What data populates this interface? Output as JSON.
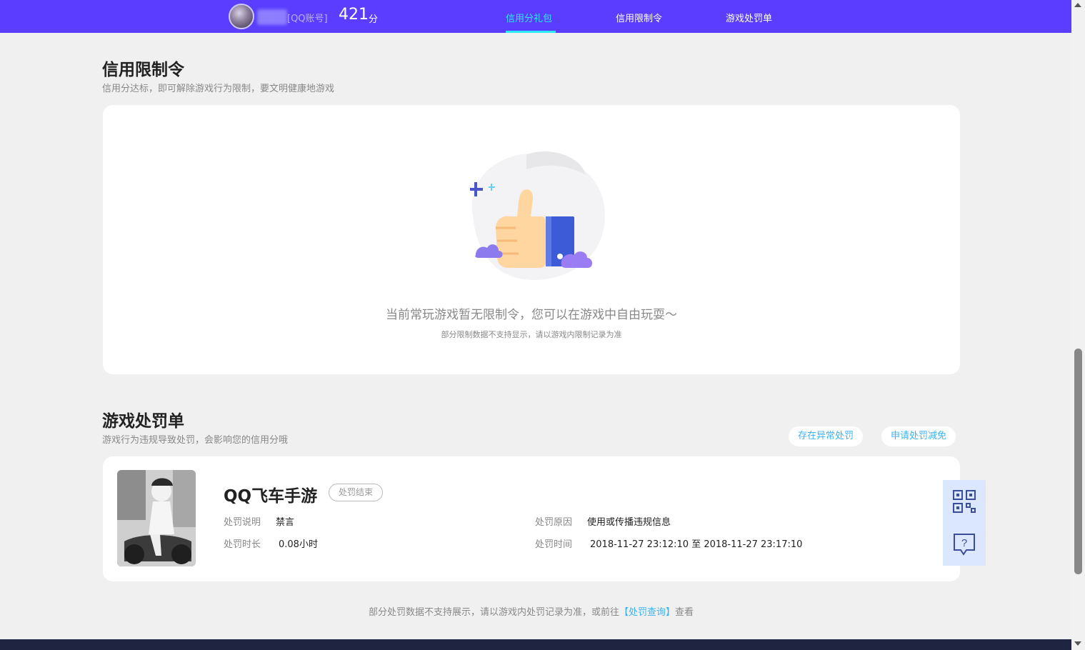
{
  "header": {
    "account_type": "[QQ账号]",
    "score": "421",
    "score_unit": "分",
    "tabs": [
      {
        "label": "信用分礼包",
        "active": true
      },
      {
        "label": "信用限制令",
        "active": false
      },
      {
        "label": "游戏处罚单",
        "active": false
      }
    ]
  },
  "restriction": {
    "title": "信用限制令",
    "subtitle": "信用分达标，即可解除游戏行为限制，要文明健康地游戏",
    "empty_main": "当前常玩游戏暂无限制令，您可以在游戏中自由玩耍～",
    "empty_sub": "部分限制数据不支持显示，请以游戏内限制记录为准"
  },
  "penalty": {
    "title": "游戏处罚单",
    "subtitle": "游戏行为违规导致处罚，会影响您的信用分哦",
    "btn_abnormal": "存在异常处罚",
    "btn_reduce": "申请处罚减免",
    "record": {
      "game_name": "QQ飞车手游",
      "status": "处罚结束",
      "desc_label": "处罚说明",
      "desc_value": "禁言",
      "duration_label": "处罚时长",
      "duration_value": "0.08小时",
      "reason_label": "处罚原因",
      "reason_value": "使用或传播违规信息",
      "time_label": "处罚时间",
      "time_value": "2018-11-27 23:12:10 至 2018-11-27 23:17:10"
    },
    "footer_prefix": "部分处罚数据不支持展示，请以游戏内处罚记录为准，或前往",
    "footer_link": "【处罚查询】",
    "footer_suffix": "查看"
  },
  "icons": {
    "qr": "qr-code-icon",
    "help": "help-chat-icon",
    "thumb": "thumbs-up-illustration"
  },
  "colors": {
    "topbar": "#5a3dff",
    "accent": "#2ee9f6",
    "link": "#3cb3f0"
  }
}
